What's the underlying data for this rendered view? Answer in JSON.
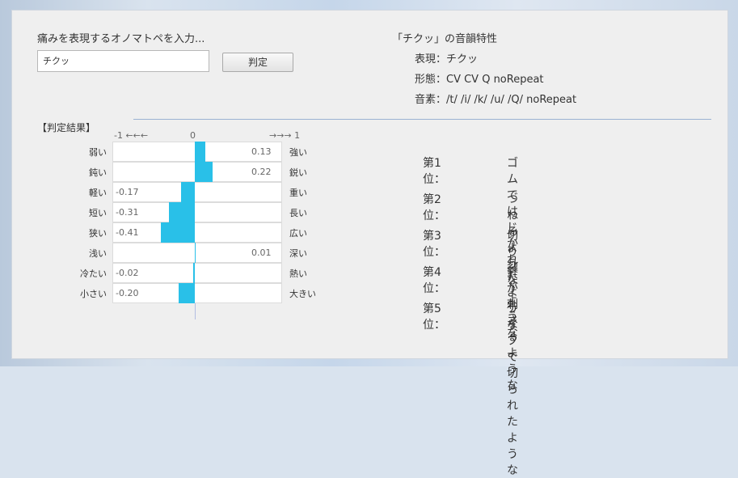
{
  "input": {
    "prompt": "痛みを表現するオノマトペを入力...",
    "value": "チクッ",
    "button_label": "判定"
  },
  "properties": {
    "title": "「チクッ」の音韻特性",
    "expression": "表現：チクッ",
    "form": "形態：CV CV Q noRepeat",
    "phoneme": "音素：/t/ /i/ /k/ /u/ /Q/ noRepeat"
  },
  "results": {
    "title": "【判定結果】",
    "scale": [
      "-1  ←←←",
      "0",
      "→→→ 1"
    ],
    "rows": [
      {
        "left": "弱い",
        "right": "強い",
        "value": 0.13,
        "text": "0.13",
        "side": "right"
      },
      {
        "left": "鈍い",
        "right": "鋭い",
        "value": 0.22,
        "text": "0.22",
        "side": "right"
      },
      {
        "left": "軽い",
        "right": "重い",
        "value": -0.17,
        "text": "-0.17",
        "side": "left"
      },
      {
        "left": "短い",
        "right": "長い",
        "value": -0.31,
        "text": "-0.31",
        "side": "left"
      },
      {
        "left": "狭い",
        "right": "広い",
        "value": -0.41,
        "text": "-0.41",
        "side": "left"
      },
      {
        "left": "浅い",
        "right": "深い",
        "value": 0.01,
        "text": "0.01",
        "side": "right"
      },
      {
        "left": "冷たい",
        "right": "熱い",
        "value": -0.02,
        "text": "-0.02",
        "side": "left"
      },
      {
        "left": "小さい",
        "right": "大きい",
        "value": -0.2,
        "text": "-0.20",
        "side": "left"
      }
    ]
  },
  "rankings": [
    {
      "rank": "第1位：",
      "text": "ゴムではじかれたような"
    },
    {
      "rank": "第2位：",
      "text": "つねるような"
    },
    {
      "rank": "第3位：",
      "text": "切り裂くような"
    },
    {
      "rank": "第4位：",
      "text": "針が刺さるような"
    },
    {
      "rank": "第5位：",
      "text": "ナイフで切られたような"
    }
  ],
  "colors": {
    "bar": "#29c0e8",
    "divider": "#9bb2d2"
  }
}
